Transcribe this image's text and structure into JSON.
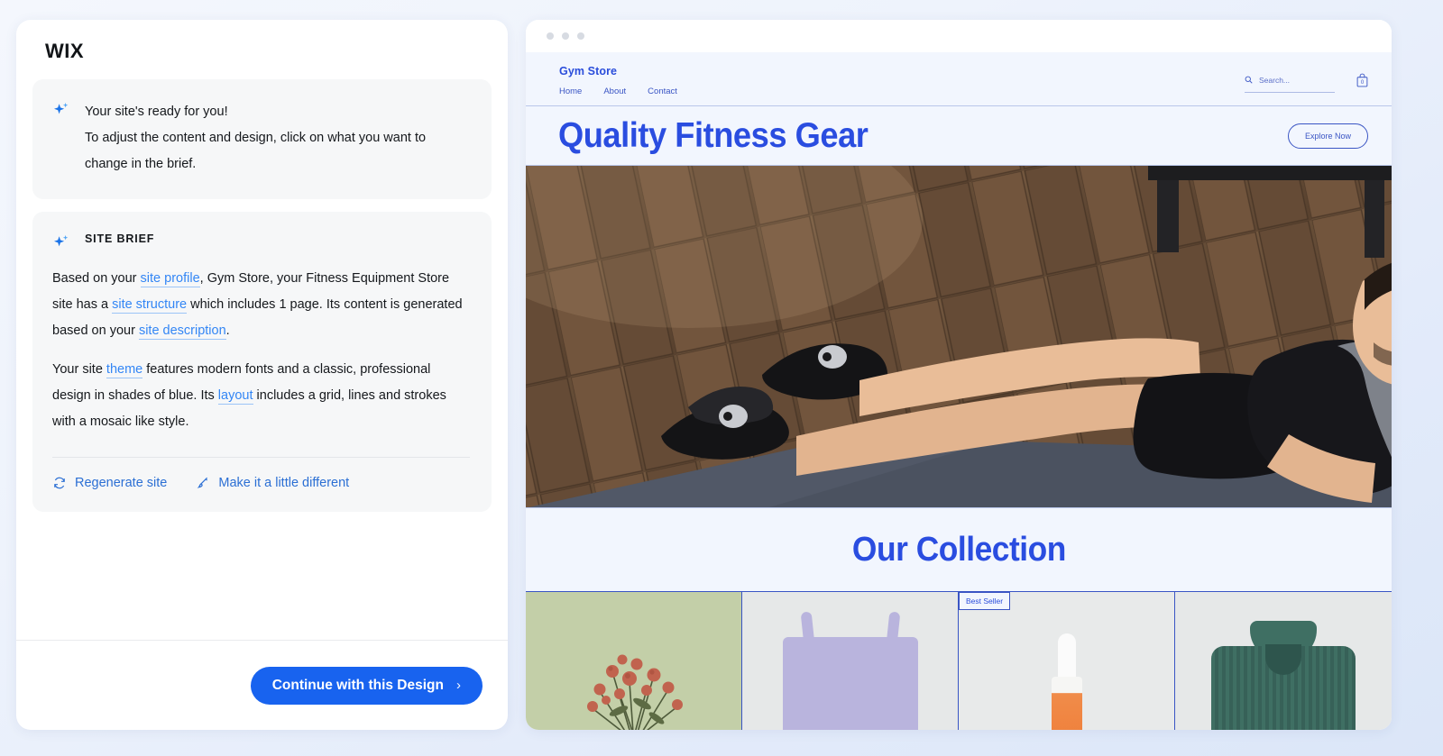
{
  "left_panel": {
    "brand": "WIX",
    "ready_card": {
      "icon": "sparkle-icon",
      "lines": [
        "Your site's ready for you!",
        "To adjust the content and design, click on what you want to change in the brief."
      ]
    },
    "site_brief": {
      "icon": "sparkle-icon",
      "title": "SITE BRIEF",
      "paragraph1": {
        "seg1": "Based on your ",
        "link1": "site profile",
        "seg2": ", Gym Store, your Fitness Equipment Store site has a ",
        "link2": "site structure",
        "seg3": " which includes 1 page. Its content is generated based on your ",
        "link3": "site description",
        "seg4": "."
      },
      "paragraph2": {
        "seg1": "Your site ",
        "link1": "theme",
        "seg2": " features modern fonts and a classic, professional design in shades of blue. Its ",
        "link2": "layout",
        "seg3": " includes a grid, lines and strokes with a mosaic like style."
      },
      "actions": [
        {
          "icon": "refresh-icon",
          "label": "Regenerate site"
        },
        {
          "icon": "brush-icon",
          "label": "Make it a little different"
        }
      ]
    },
    "footer": {
      "cta_label": "Continue with this Design",
      "cta_chevron": "›"
    }
  },
  "preview": {
    "window_dots": 3,
    "site": {
      "logo": "Gym Store",
      "nav": [
        "Home",
        "About",
        "Contact"
      ],
      "search": {
        "icon": "search-icon",
        "placeholder": "Search..."
      },
      "cart": {
        "icon": "cart-icon",
        "count": "0"
      },
      "hero": {
        "title": "Quality Fitness Gear",
        "button": "Explore Now",
        "image_alt": "man doing cobra stretch on yoga mat over herringbone wood floor"
      },
      "collection": {
        "title": "Our Collection",
        "products": [
          {
            "name": "dried-flowers",
            "badge": ""
          },
          {
            "name": "tote-bag",
            "badge": ""
          },
          {
            "name": "dropper-bottle",
            "badge": "Best Seller"
          },
          {
            "name": "knit-sweater",
            "badge": ""
          }
        ]
      }
    }
  },
  "colors": {
    "cta_blue": "#1863ef",
    "link_blue": "#3386f5",
    "site_blue": "#2a4de0",
    "site_bg": "#f2f6fe",
    "card_grey": "#f6f7f8"
  }
}
